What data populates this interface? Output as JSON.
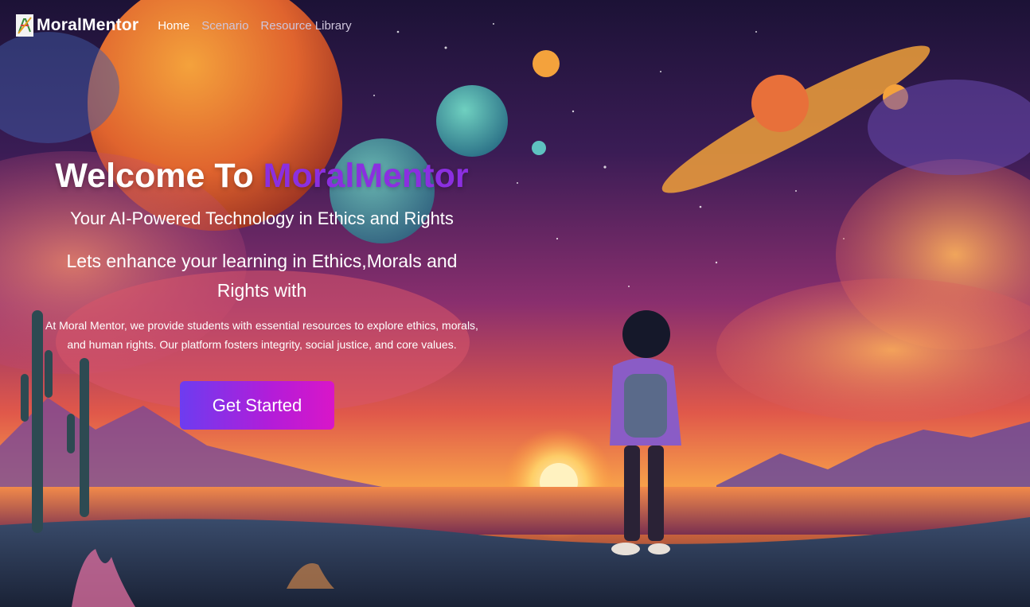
{
  "nav": {
    "brand": "MoralMentor",
    "links": [
      {
        "label": "Home",
        "active": true
      },
      {
        "label": "Scenario",
        "active": false
      },
      {
        "label": "Resource Library",
        "active": false
      }
    ]
  },
  "hero": {
    "title_prefix": "Welcome To",
    "title_accent": "MoralMentor",
    "subtitle": "Your AI-Powered Technology in Ethics and Rights",
    "tagline": "Lets enhance your learning in Ethics,Morals and Rights with",
    "description": "At Moral Mentor, we provide students with essential resources to explore ethics, morals, and human rights. Our platform fosters integrity, social justice, and core values.",
    "cta_label": "Get Started"
  },
  "colors": {
    "accent": "#8b2fe0",
    "button_gradient_start": "#6d3cf0",
    "button_gradient_end": "#d916c8"
  },
  "icons": {
    "logo": "scales-logo-icon"
  }
}
